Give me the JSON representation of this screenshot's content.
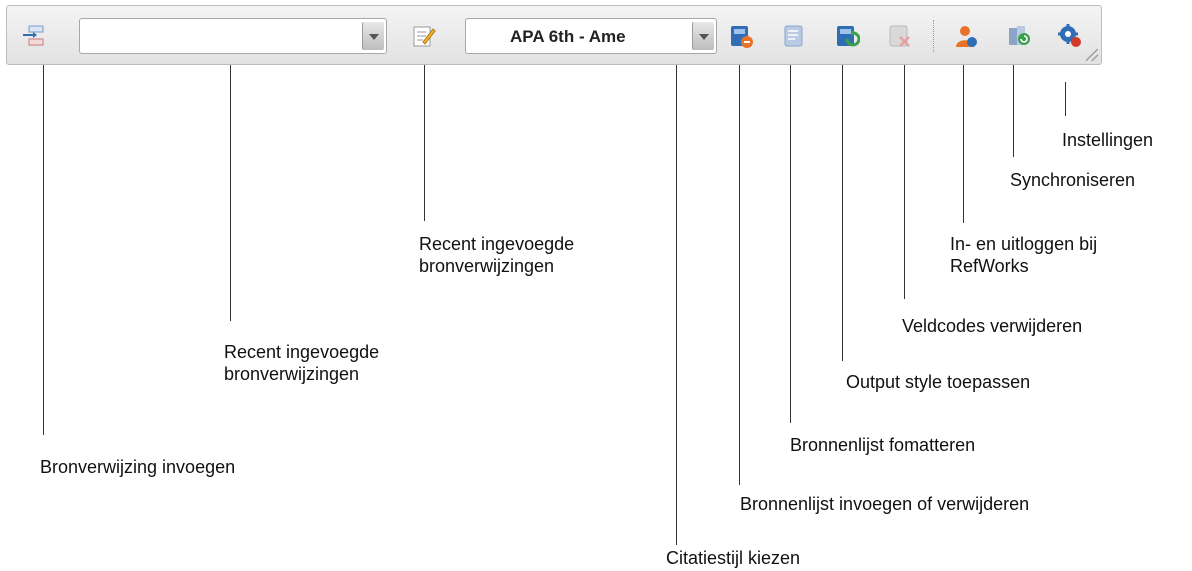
{
  "toolbar": {
    "recent_combo_value": "",
    "style_combo_value": "APA 6th - Ame",
    "icons": [
      "insert-citation-icon",
      "edit-citation-icon",
      "insert-bibliography-icon",
      "format-bibliography-icon",
      "apply-output-style-icon",
      "remove-field-codes-icon",
      "login-refworks-icon",
      "sync-icon",
      "settings-icon"
    ],
    "colors": {
      "blue": "#2f6db5",
      "orange": "#e8722a",
      "green": "#3aa04a",
      "red": "#d23a2a",
      "gray": "#a8a8a8"
    }
  },
  "labels": {
    "insert_citation": "Bronverwijzing invoegen",
    "recent_dropdown_1": "Recent ingevoegde",
    "recent_dropdown_2": "bronverwijzingen",
    "recent_edit_1": "Recent ingevoegde",
    "recent_edit_2": "bronverwijzingen",
    "citation_style": "Citatiestijl kiezen",
    "insert_bibliography": "Bronnenlijst invoegen of verwijderen",
    "format_bibliography": "Bronnenlijst fomatteren",
    "apply_style": "Output style toepassen",
    "remove_codes": "Veldcodes verwijderen",
    "login_1": "In- en uitloggen bij",
    "login_2": "RefWorks",
    "sync": "Synchroniseren",
    "settings": "Instellingen"
  }
}
